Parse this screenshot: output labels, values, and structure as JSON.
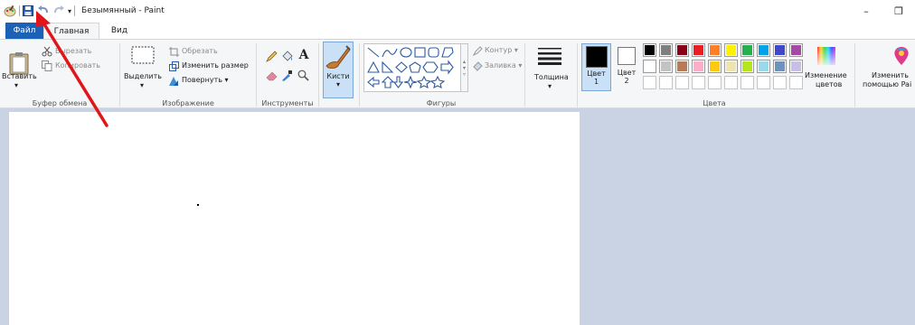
{
  "window": {
    "title": "Безымянный - Paint",
    "minimize_glyph": "–",
    "restore_glyph": "❐"
  },
  "tabs": [
    {
      "label": "Файл"
    },
    {
      "label": "Главная"
    },
    {
      "label": "Вид"
    }
  ],
  "ribbon": {
    "clipboard": {
      "group_label": "Буфер обмена",
      "paste_label": "Вставить",
      "cut_label": "Вырезать",
      "copy_label": "Копировать"
    },
    "image": {
      "group_label": "Изображение",
      "select_label": "Выделить",
      "crop_label": "Обрезать",
      "resize_label": "Изменить размер",
      "rotate_label": "Повернуть ▾"
    },
    "tools": {
      "group_label": "Инструменты"
    },
    "brushes": {
      "label": "Кисти"
    },
    "shapes": {
      "group_label": "Фигуры",
      "outline_label": "Контур ▾",
      "fill_label": "Заливка ▾"
    },
    "size": {
      "label": "Толщина"
    },
    "colors": {
      "group_label": "Цвета",
      "color1_label": "Цвет",
      "color1_num": "1",
      "color2_label": "Цвет",
      "color2_num": "2",
      "edit_label_line1": "Изменение",
      "edit_label_line2": "цветов",
      "paint3d_line1": "Изменить",
      "paint3d_line2": "помощью Pai",
      "color1": "#000000",
      "color2": "#ffffff",
      "palette_row1": [
        "#000000",
        "#7f7f7f",
        "#880015",
        "#ed1c24",
        "#ff7f27",
        "#fff200",
        "#22b14c",
        "#00a2e8",
        "#3f48cc",
        "#a349a4"
      ],
      "palette_row2": [
        "#ffffff",
        "#c3c3c3",
        "#b97a57",
        "#ffaec9",
        "#ffc90e",
        "#efe4b0",
        "#b5e61d",
        "#99d9ea",
        "#7092be",
        "#c8bfe7"
      ]
    }
  }
}
